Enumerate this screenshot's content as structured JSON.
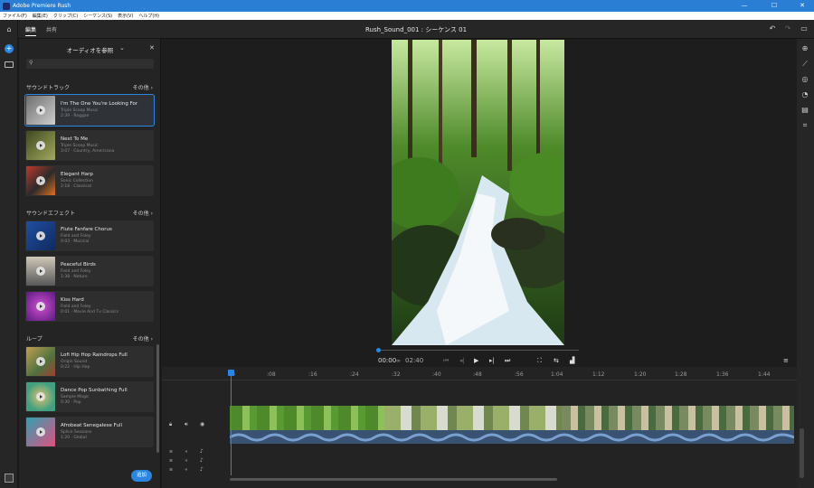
{
  "window": {
    "title": "Adobe Premiere Rush",
    "controls": [
      "—",
      "☐",
      "✕"
    ]
  },
  "menu": [
    "ファイル(F)",
    "編集(E)",
    "クリップ(C)",
    "シーケンス(S)",
    "表示(V)",
    "ヘルプ(H)"
  ],
  "topbar": {
    "tabs": [
      "編集",
      "共有"
    ],
    "project_title": "Rush_Sound_001 : シーケンス 01"
  },
  "panel": {
    "title": "オーディオを参照",
    "sections": [
      {
        "title": "サウンドトラック",
        "more": "その他",
        "items": [
          {
            "title": "I'm The One You're Looking For",
            "author": "Triple Scoop Music",
            "meta": "2:39 · Reggae",
            "colors": [
              "#7a7a7a",
              "#c8c8c8"
            ]
          },
          {
            "title": "Next To Me",
            "author": "Triple Scoop Music",
            "meta": "3:07 · Country, Americana",
            "colors": [
              "#5b6a2a",
              "#9aa05a"
            ]
          },
          {
            "title": "Elegant Harp",
            "author": "Sonic Collection",
            "meta": "2:18 · Classical",
            "colors": [
              "#c0392b",
              "#2b2b2b"
            ]
          }
        ]
      },
      {
        "title": "サウンドエフェクト",
        "more": "その他",
        "items": [
          {
            "title": "Flute Fanfare Chorus",
            "author": "Field and Foley",
            "meta": "0:03 · Musical",
            "colors": [
              "#1f4fa0",
              "#d0a060"
            ]
          },
          {
            "title": "Peaceful Birds",
            "author": "Field and Foley",
            "meta": "1:38 · Nature",
            "colors": [
              "#b8b0a0",
              "#505050"
            ]
          },
          {
            "title": "Kiss Hard",
            "author": "Field and Foley",
            "meta": "0:01 · Movie And Tv Classics",
            "colors": [
              "#8a2ab0",
              "#c040c0"
            ]
          }
        ]
      },
      {
        "title": "ループ",
        "more": "その他",
        "items": [
          {
            "title": "Lofi Hip Hop Raindrops Full",
            "author": "Origin Sound",
            "meta": "0:22 · Hip Hop",
            "colors": [
              "#c0a050",
              "#507040"
            ]
          },
          {
            "title": "Dance Pop Sunbathing Full",
            "author": "Sample Magic",
            "meta": "0:30 · Pop",
            "colors": [
              "#40a080",
              "#e0a040"
            ]
          },
          {
            "title": "Afrobeat Senegalese Full",
            "author": "Splice Sessions",
            "meta": "1:20 · Global",
            "colors": [
              "#30a0b0",
              "#e05080"
            ]
          }
        ]
      }
    ],
    "add_label": "追加"
  },
  "viewer": {
    "timecode_current": "00:00",
    "timecode_total": "02:40",
    "progress": 0.0
  },
  "timeline": {
    "ruler": [
      "0",
      ":08",
      ":16",
      ":24",
      ":32",
      ":40",
      ":48",
      ":56",
      "1:04",
      "1:12",
      "1:20",
      "1:28",
      "1:36",
      "1:44"
    ]
  },
  "colors": {
    "accent": "#2a86e0",
    "titlebar": "#2a7fd4",
    "waveform": "#4a6a96"
  }
}
